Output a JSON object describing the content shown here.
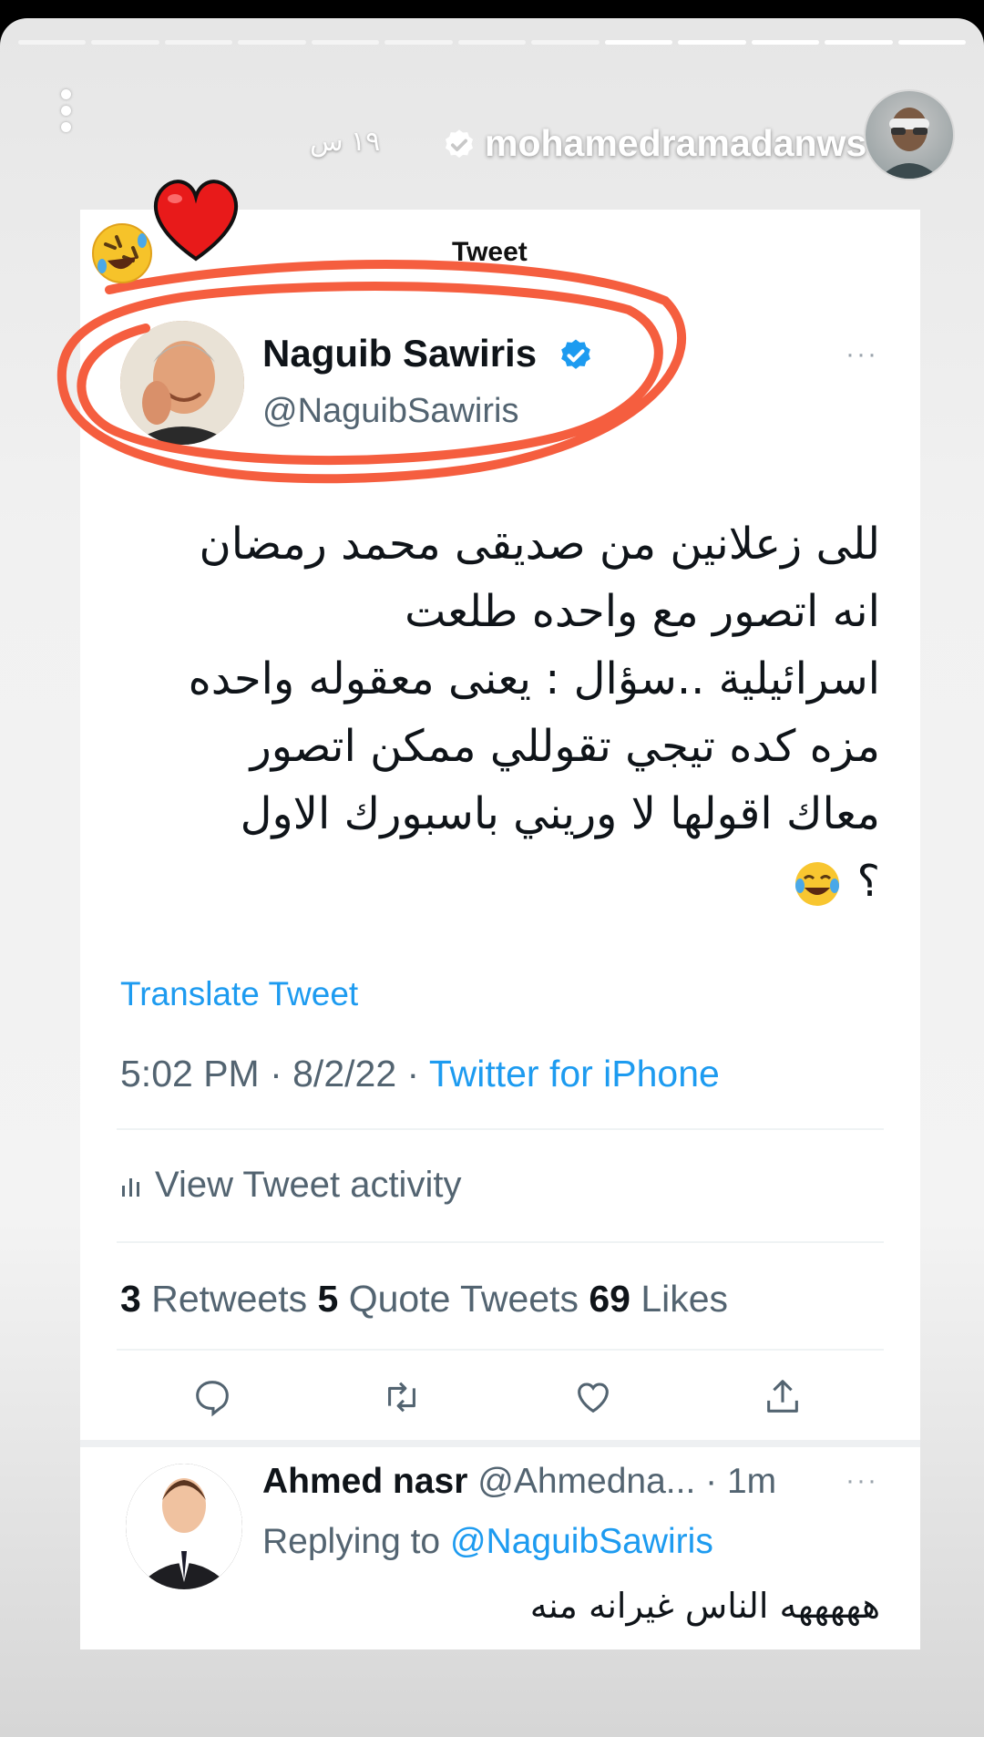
{
  "story": {
    "progress_segments_total": 13,
    "progress_segments_done": 9,
    "username": "mohamedramadanws",
    "time_ago": "١٩ س"
  },
  "tweet": {
    "header": "Tweet",
    "author_name": "Naguib Sawiris",
    "author_handle": "@NaguibSawiris",
    "more": "···",
    "text_lines": [
      "للى زعلانين من صديقى محمد رمضان",
      "انه اتصور مع واحده طلعت",
      "اسرائيلية ..سؤال : يعنى معقوله واحده",
      "مزه كده تيجي تقوللي ممكن اتصور",
      "معاك اقولها لا وريني باسبورك الاول",
      "؟"
    ],
    "translate_label": "Translate Tweet",
    "timestamp": "5:02 PM · 8/2/22 · ",
    "source": "Twitter for iPhone",
    "activity_label": "View Tweet activity",
    "stats": {
      "retweets_count": "3",
      "retweets_label": " Retweets ",
      "quotes_count": "5",
      "quotes_label": " Quote Tweets ",
      "likes_count": "69",
      "likes_label": " Likes"
    }
  },
  "reply": {
    "name": "Ahmed nasr",
    "handle_time": " @Ahmedna... · 1m",
    "more": "···",
    "replying_prefix": "Replying to ",
    "replying_to": "@NaguibSawiris",
    "text": "هههههه الناس غيرانه منه"
  },
  "colors": {
    "twitter_blue": "#1d9bf0",
    "marker_red": "#f4502f",
    "heart_red": "#e81a1a"
  },
  "icons": [
    "verified-badge-icon",
    "laughing-emoji-sticker",
    "heart-emoji-sticker",
    "reply-icon",
    "retweet-icon",
    "like-icon",
    "share-icon",
    "bar-chart-icon",
    "menu-dots-icon"
  ]
}
